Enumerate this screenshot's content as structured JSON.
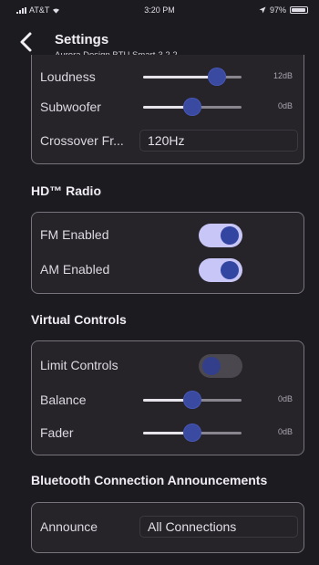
{
  "status_bar": {
    "carrier": "AT&T",
    "time": "3:20 PM",
    "battery_text": "97%",
    "battery_level": 0.97
  },
  "nav": {
    "back_icon": "chevron-left-icon",
    "title": "Settings",
    "subtitle": "Aurora Design BTU Smart-3.2.2"
  },
  "audio": {
    "loudness": {
      "label": "Loudness",
      "value": "12dB",
      "level": 0.75
    },
    "subwoofer": {
      "label": "Subwoofer",
      "value": "0dB",
      "level": 0.5
    },
    "crossover": {
      "label": "Crossover Fr...",
      "value": "120Hz"
    }
  },
  "hd_radio": {
    "title": "HD™ Radio",
    "fm": {
      "label": "FM Enabled",
      "on": true
    },
    "am": {
      "label": "AM Enabled",
      "on": true
    }
  },
  "virtual_controls": {
    "title": "Virtual Controls",
    "limit": {
      "label": "Limit Controls",
      "on": false
    },
    "balance": {
      "label": "Balance",
      "value": "0dB",
      "level": 0.5
    },
    "fader": {
      "label": "Fader",
      "value": "0dB",
      "level": 0.5
    }
  },
  "bluetooth": {
    "title": "Bluetooth Connection Announcements",
    "announce": {
      "label": "Announce",
      "value": "All Connections"
    }
  },
  "colors": {
    "background": "#1c1b1f",
    "card": "#262428",
    "accent": "#3245a0",
    "toggle_on": "#c7c6f6"
  }
}
